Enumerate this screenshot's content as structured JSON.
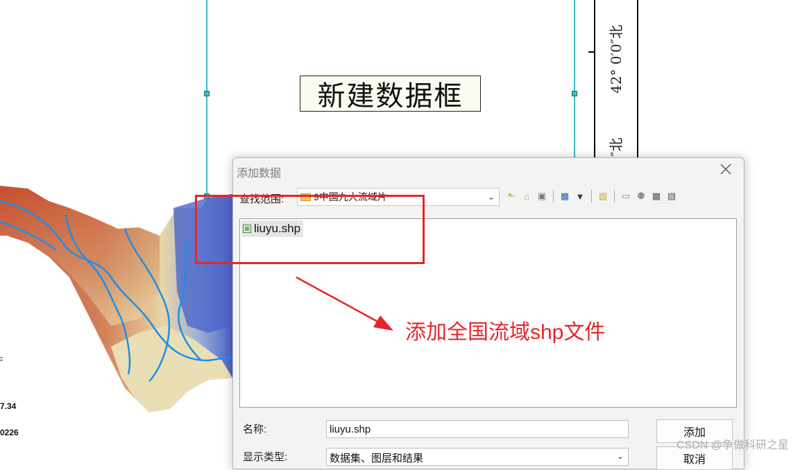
{
  "layout_view": {
    "frame_title": "新建数据框",
    "grid_label_top": "42° 0′0″北",
    "grid_label_bottom": "″北",
    "legend_values": [
      "7.34",
      "0226"
    ],
    "legend_tick": "F"
  },
  "dialog": {
    "title": "添加数据",
    "look_in_label": "查找范围:",
    "look_in_value": "9中国九大流域片",
    "files": [
      {
        "name": "liuyu.shp",
        "icon": "shapefile-polygon-icon",
        "selected": true
      }
    ],
    "name_label": "名称:",
    "name_value": "liuyu.shp",
    "type_label": "显示类型:",
    "type_value": "数据集、图层和结果",
    "add_button": "添加",
    "cancel_button": "取消",
    "toolbar_icons": [
      "up-one-level-icon",
      "home-icon",
      "connect-folder-icon",
      "list-view-icon",
      "view-options-chevron-icon",
      "new-folder-icon",
      "connect-icon",
      "database-icon",
      "gis-server-icon",
      "toolbox-icon"
    ]
  },
  "annotation": {
    "text": "添加全国流域shp文件",
    "color": "#e8242a"
  },
  "watermark": "CSDN @争做科研之星",
  "colors": {
    "guide": "#3bbcc4",
    "river": "#1e8ee8",
    "terrain_high": "#c64a2a",
    "terrain_low": "#4a63c9"
  }
}
